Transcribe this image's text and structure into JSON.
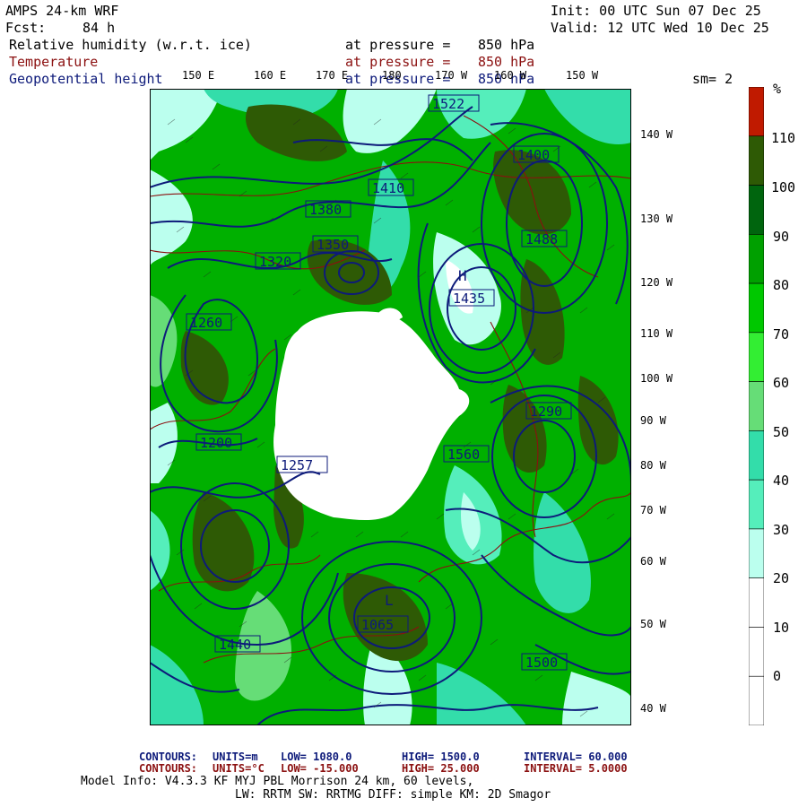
{
  "header": {
    "model": "AMPS 24-km WRF",
    "fcst_label": "Fcst:",
    "fcst_value": "84 h",
    "init": "Init: 00 UTC Sun 07 Dec 25",
    "valid": "Valid: 12 UTC Wed 10 Dec 25",
    "smoothing": "sm= 2"
  },
  "fields": [
    {
      "name": "Relative humidity (w.r.t. ice)",
      "pressure": "at pressure =",
      "level": "850 hPa",
      "color": "#000000"
    },
    {
      "name": "Temperature",
      "pressure": "at pressure =",
      "level": "850 hPa",
      "color": "#8b1010"
    },
    {
      "name": "Geopotential height",
      "pressure": "at pressure =",
      "level": "850 hPa",
      "color": "#0d1a7a"
    }
  ],
  "longitude_labels_top": [
    "150 E",
    "160 E",
    "170 E",
    "180",
    "170 W",
    "160 W",
    "150 W"
  ],
  "longitude_labels_right": [
    "140 W",
    "130 W",
    "120 W",
    "110 W",
    "100 W",
    "90 W",
    "80 W",
    "70 W",
    "60 W",
    "50 W",
    "40 W"
  ],
  "colorbar": {
    "unit": "%",
    "labels": [
      "110",
      "100",
      "90",
      "80",
      "70",
      "60",
      "50",
      "40",
      "30",
      "20",
      "10",
      "0"
    ],
    "colors": [
      "#c01a00",
      "#2e5a05",
      "#00650e",
      "#00a000",
      "#00c800",
      "#33ee33",
      "#66dd77",
      "#33ddaa",
      "#55eebb",
      "#bbffee",
      "#ffffff",
      "#ffffff",
      "#ffffff"
    ]
  },
  "map_labels": [
    {
      "text": "1380",
      "kind": "height"
    },
    {
      "text": "1350",
      "kind": "height"
    },
    {
      "text": "1320",
      "kind": "height"
    },
    {
      "text": "1260",
      "kind": "height"
    },
    {
      "text": "1200",
      "kind": "height"
    },
    {
      "text": "1290",
      "kind": "height"
    },
    {
      "text": "1440",
      "kind": "height"
    },
    {
      "text": "1410",
      "kind": "height"
    },
    {
      "text": "1435",
      "kind": "height"
    },
    {
      "text": "1488",
      "kind": "height"
    },
    {
      "text": "1400",
      "kind": "height"
    },
    {
      "text": "1522",
      "kind": "height"
    },
    {
      "text": "1065",
      "kind": "height"
    },
    {
      "text": "1257",
      "kind": "height"
    },
    {
      "text": "1560",
      "kind": "height"
    },
    {
      "text": "1500",
      "kind": "height"
    },
    {
      "text": "H",
      "kind": "center"
    },
    {
      "text": "L",
      "kind": "center"
    }
  ],
  "footer": {
    "c1_label": "CONTOURS:",
    "c1_units": "UNITS=m",
    "c1_low": "LOW= 1080.0",
    "c1_high": "HIGH= 1500.0",
    "c1_interval": "INTERVAL= 60.000",
    "c2_label": "CONTOURS:",
    "c2_units": "UNITS=°C",
    "c2_low": "LOW= -15.000",
    "c2_high": "HIGH= 25.000",
    "c2_interval": "INTERVAL= 5.0000",
    "model_info": "Model Info: V4.3.3 KF MYJ PBL Morrison 24 km, 60 levels,",
    "model_info2": "LW: RRTM SW: RRTMG DIFF: simple KM: 2D Smagor"
  }
}
